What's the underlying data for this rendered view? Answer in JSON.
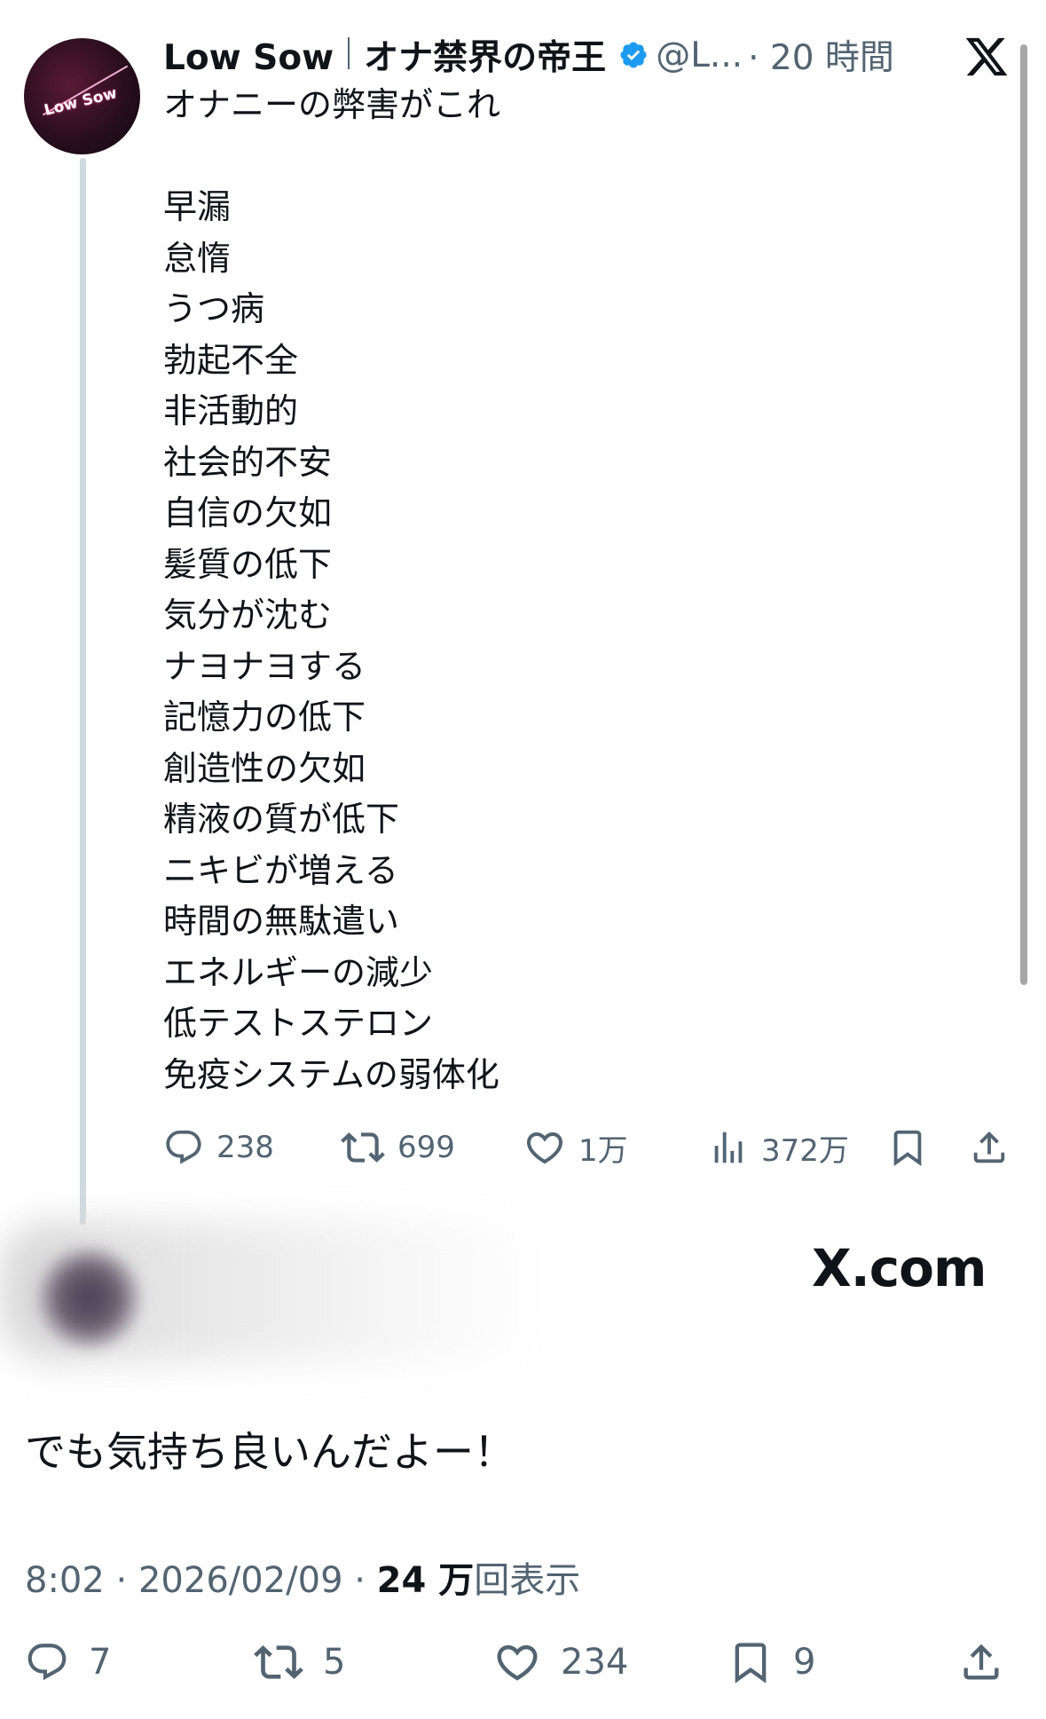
{
  "quoted_tweet": {
    "display_name": "Low Sow",
    "name_suffix": "オナ禁界の帝王",
    "handle": "@L...",
    "time": "· 20 時間",
    "avatar_text": "Low Sow",
    "lines": [
      "オナニーの弊害がこれ",
      "",
      "早漏",
      "怠惰",
      "うつ病",
      "勃起不全",
      "非活動的",
      "社会的不安",
      "自信の欠如",
      "髪質の低下",
      "気分が沈む",
      "ナヨナヨする",
      "記憶力の低下",
      "創造性の欠如",
      "精液の質が低下",
      "ニキビが増える",
      "時間の無駄遣い",
      "エネルギーの減少",
      "低テストステロン",
      "免疫システムの弱体化"
    ],
    "actions": {
      "replies": "238",
      "reposts": "699",
      "likes": "1万",
      "views": "372万"
    }
  },
  "watermark": "X.com",
  "reply": {
    "text": "でも気持ち良いんだよー！",
    "time": "8:02 · 2026/02/09 · ",
    "views_count": "24 万",
    "views_label": "回表示",
    "actions": {
      "replies": "7",
      "reposts": "5",
      "likes": "234",
      "bookmarks": "9"
    }
  },
  "colors": {
    "verified": "#1d9bf0",
    "secondary_text": "#536471",
    "primary_text": "#0f1419"
  },
  "icons": [
    "verified-badge-icon",
    "x-logo-icon",
    "reply-icon",
    "repost-icon",
    "like-icon",
    "views-icon",
    "bookmark-icon",
    "share-icon"
  ]
}
